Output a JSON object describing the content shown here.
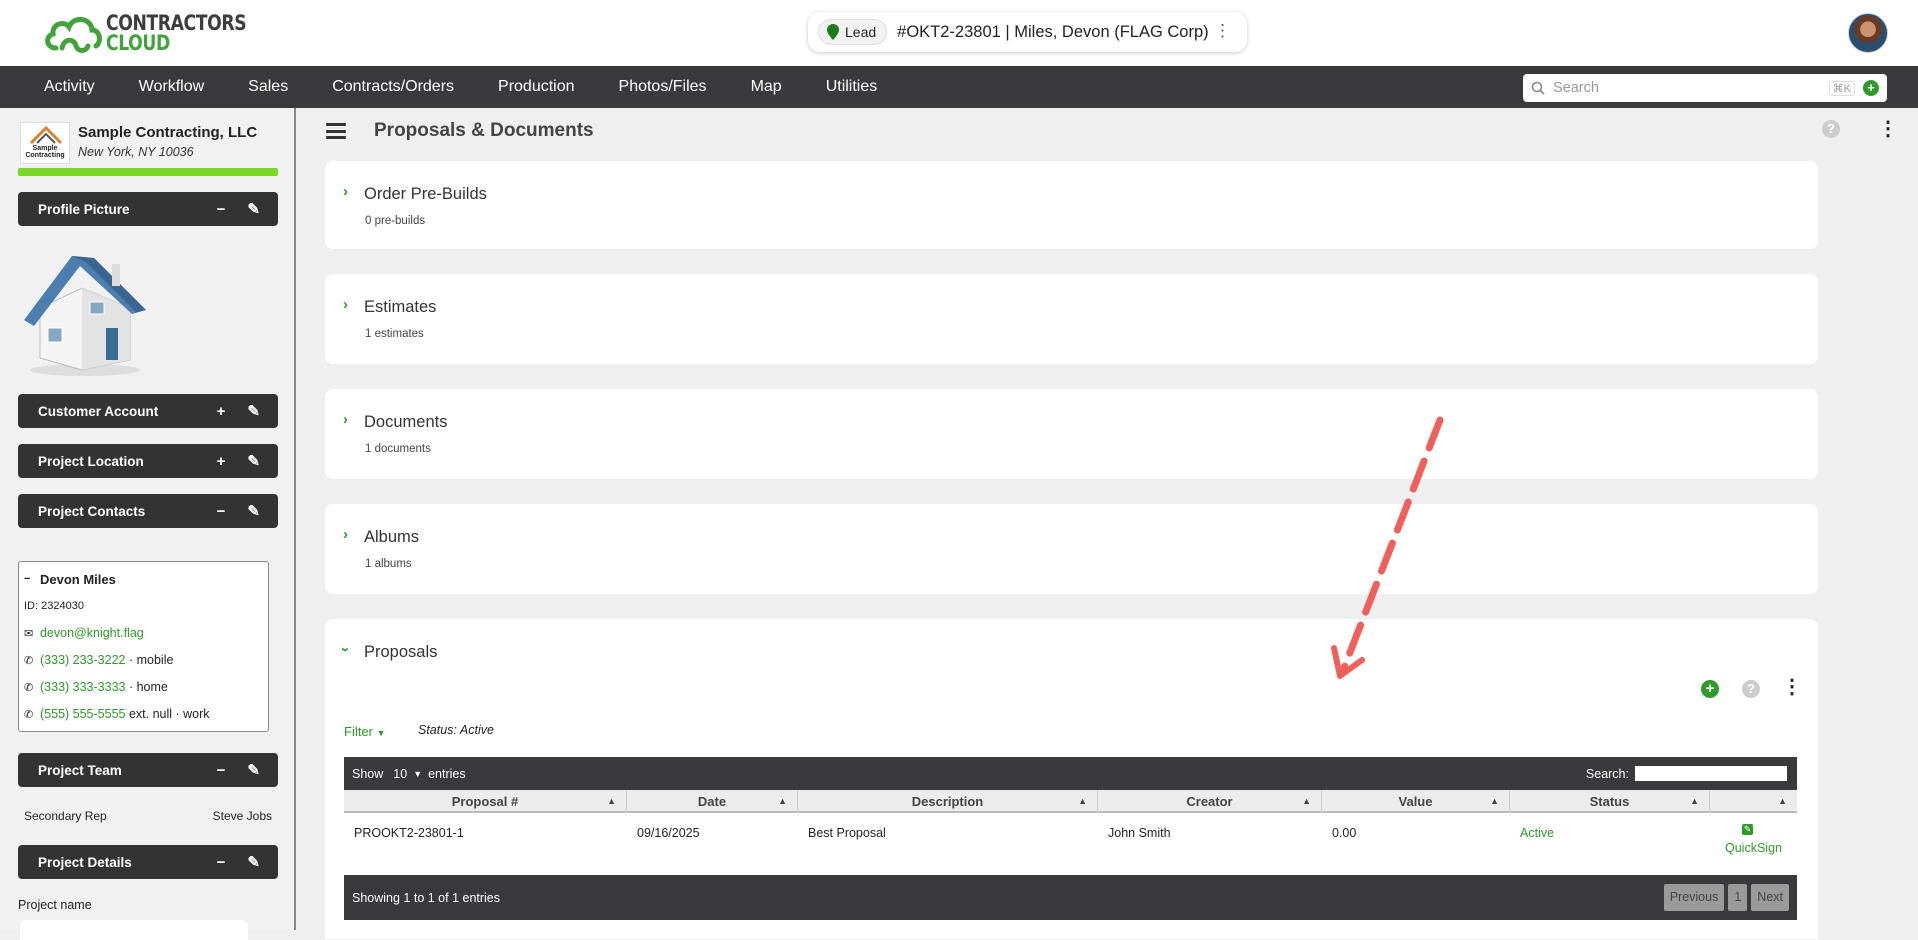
{
  "logo": {
    "line1": "CONTRACTORS",
    "line2": "CLOUD"
  },
  "lead": {
    "badge": "Lead",
    "title": "#OKT2-23801 | Miles, Devon (FLAG Corp)"
  },
  "nav": [
    "Activity",
    "Workflow",
    "Sales",
    "Contracts/Orders",
    "Production",
    "Photos/Files",
    "Map",
    "Utilities"
  ],
  "search": {
    "placeholder": "Search",
    "shortcut": "⌘K"
  },
  "company": {
    "name": "Sample Contracting, LLC",
    "address": "New York, NY 10036",
    "logo_text": "Sample Contracting"
  },
  "sidebar": {
    "profile_picture": "Profile Picture",
    "customer_account": "Customer Account",
    "project_location": "Project Location",
    "project_contacts": "Project Contacts",
    "project_team": "Project Team",
    "project_details": "Project Details",
    "project_name_label": "Project name"
  },
  "contact": {
    "name": "Devon Miles",
    "id": "ID: 2324030",
    "email": "devon@knight.flag",
    "phone1": "(333) 233-3222",
    "phone1_type": "· mobile",
    "phone2": "(333) 333-3333",
    "phone2_type": "· home",
    "phone3": "(555) 555-5555",
    "phone3_type": "ext. null · work"
  },
  "team": {
    "role": "Secondary Rep",
    "person": "Steve Jobs"
  },
  "main": {
    "title": "Proposals & Documents"
  },
  "sections": [
    {
      "title": "Order Pre-Builds",
      "sub": "0 pre-builds"
    },
    {
      "title": "Estimates",
      "sub": "1 estimates"
    },
    {
      "title": "Documents",
      "sub": "1 documents"
    },
    {
      "title": "Albums",
      "sub": "1 albums"
    },
    {
      "title": "Proposals"
    }
  ],
  "filter": {
    "label": "Filter",
    "status": "Status: Active"
  },
  "table": {
    "show": "Show",
    "length": "10",
    "entries": "entries",
    "search_label": "Search:",
    "headers": [
      "Proposal #",
      "Date",
      "Description",
      "Creator",
      "Value",
      "Status",
      ""
    ],
    "row": {
      "proposal": "PROOKT2-23801-1",
      "date": "09/16/2025",
      "description": "Best Proposal",
      "creator": "John Smith",
      "value": "0.00",
      "status": "Active",
      "action": "QuickSign"
    },
    "info": "Showing 1 to 1 of 1 entries",
    "prev": "Previous",
    "page": "1",
    "next": "Next"
  },
  "colors": {
    "accent": "#2e9a2a",
    "dark": "#3a3a3c",
    "progress": "#7ad624",
    "annotation": "#f0605a"
  }
}
